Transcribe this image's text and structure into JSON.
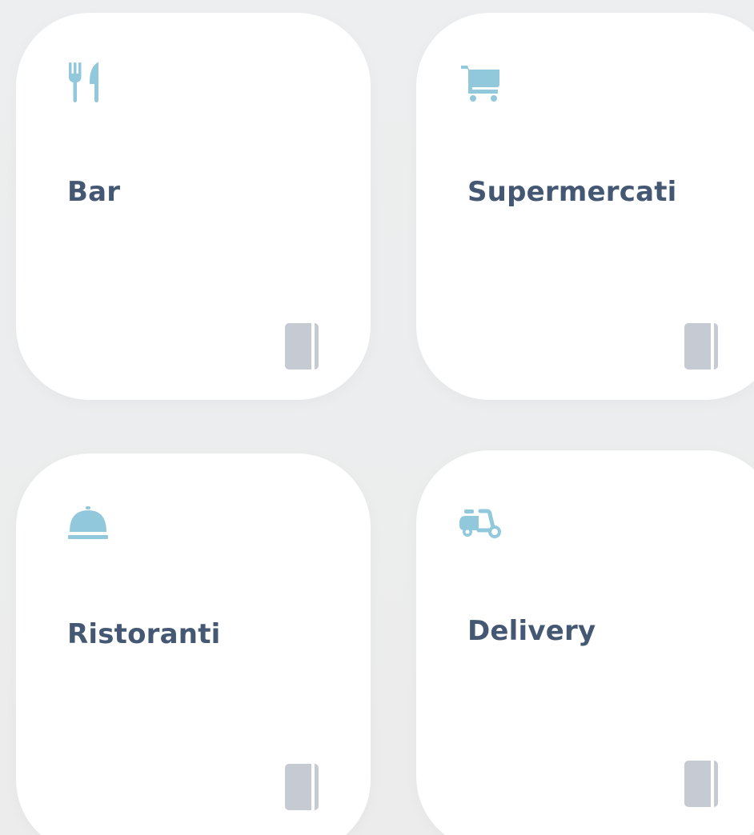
{
  "categories": [
    {
      "id": "bar",
      "label": "Bar",
      "icon": "utensils-icon"
    },
    {
      "id": "supermercati",
      "label": "Supermercati",
      "icon": "shopping-cart-icon"
    },
    {
      "id": "ristoranti",
      "label": "Ristoranti",
      "icon": "food-cloche-icon"
    },
    {
      "id": "delivery",
      "label": "Delivery",
      "icon": "scooter-icon"
    }
  ],
  "colors": {
    "icon": "#92c8dc",
    "label": "#455873",
    "badge": "#c5cad3",
    "card": "#ffffff",
    "background": "#ececec"
  }
}
